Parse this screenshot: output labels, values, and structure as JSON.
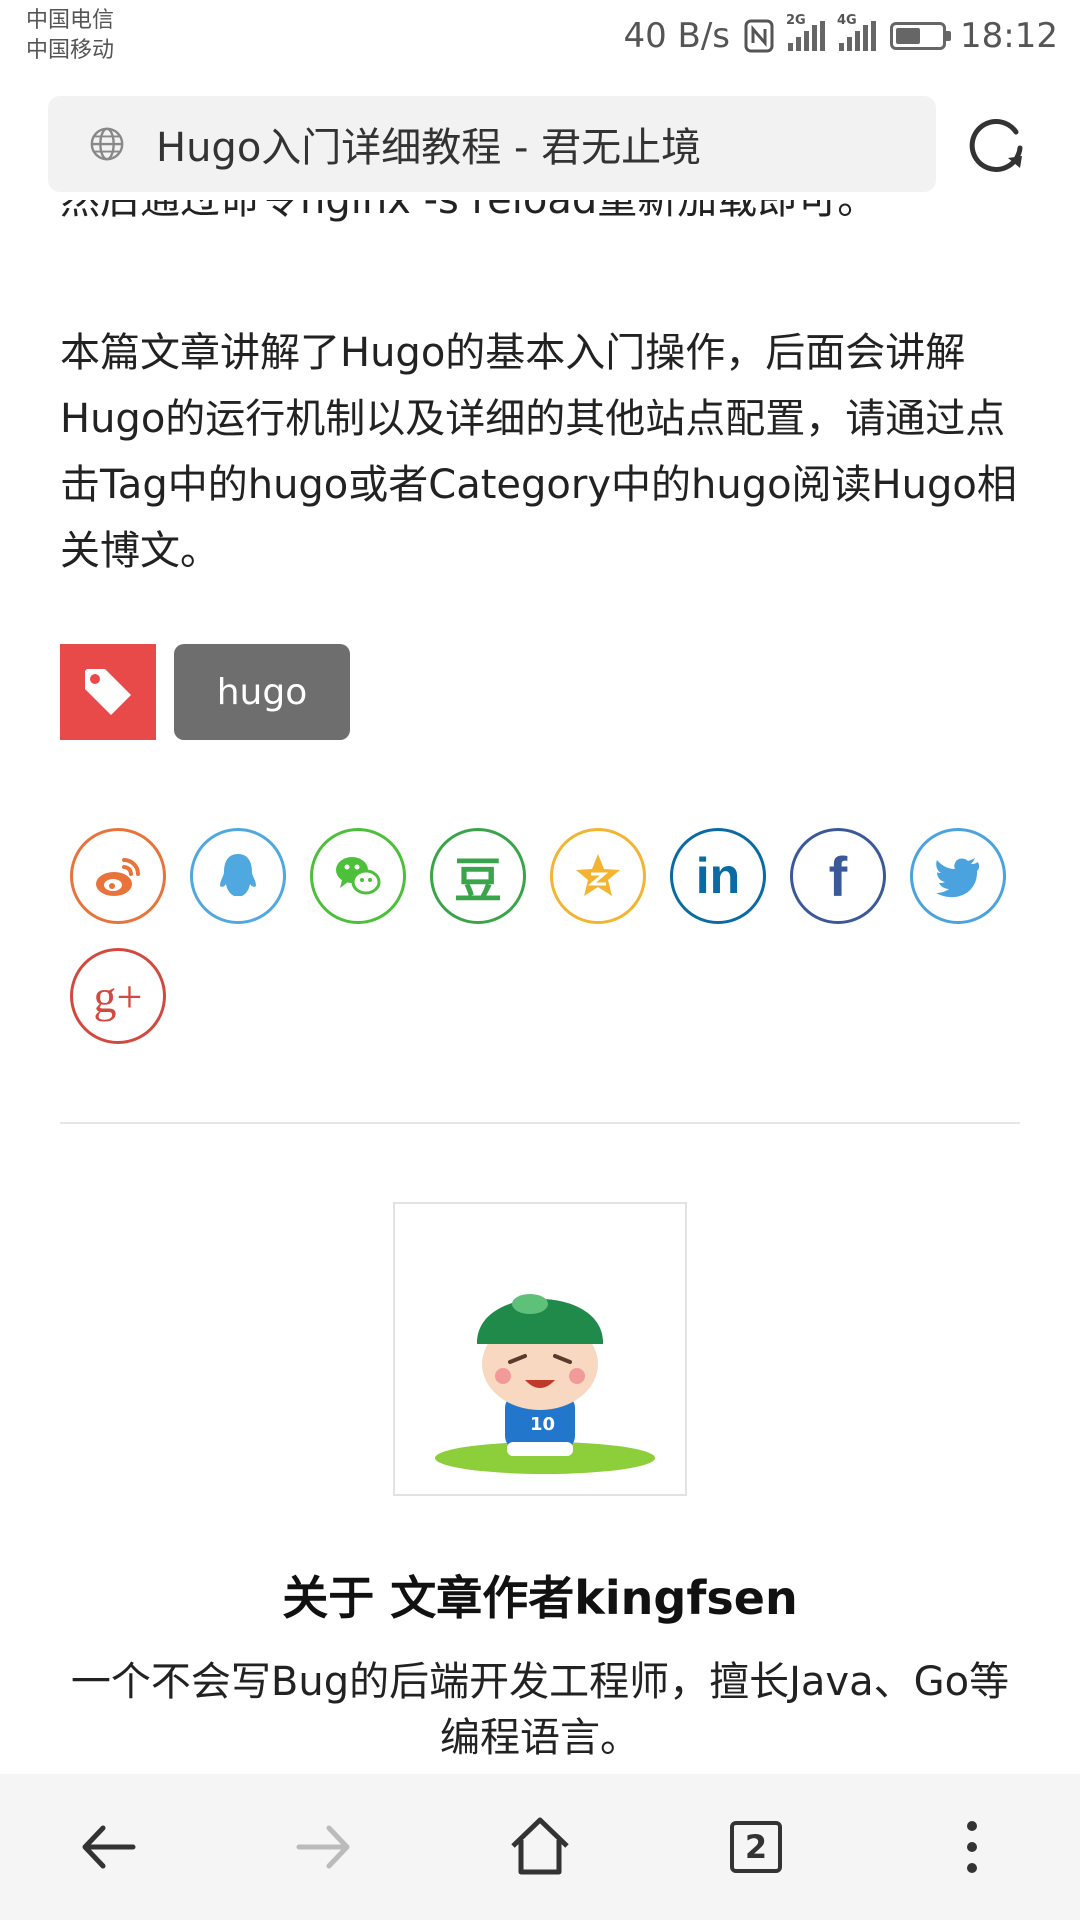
{
  "status_bar": {
    "carrier_1": "中国电信",
    "carrier_2": "中国移动",
    "network_speed": "40 B/s",
    "signal_1_label": "2G",
    "signal_2_label": "4G",
    "time": "18:12",
    "battery_level": 0.55
  },
  "address_bar": {
    "page_title": "Hugo入门详细教程 - 君无止境"
  },
  "article": {
    "cut_off_line": "然后通过命令nginx -s reload重新加载即可。",
    "paragraph": "本篇文章讲解了Hugo的基本入门操作，后面会讲解Hugo的运行机制以及详细的其他站点配置，请通过点击Tag中的hugo或者Category中的hugo阅读Hugo相关博文。",
    "tag": "hugo"
  },
  "share": {
    "icons": [
      "weibo-icon",
      "qq-icon",
      "wechat-icon",
      "douban-icon",
      "qzone-icon",
      "linkedin-icon",
      "facebook-icon",
      "twitter-icon",
      "google-plus-icon"
    ],
    "douban_glyph": "豆",
    "linkedin_glyph": "in",
    "facebook_glyph": "f",
    "gplus_glyph": "g+"
  },
  "author": {
    "title": "关于 文章作者kingfsen",
    "description": "一个不会写Bug的后端开发工程师，擅长Java、Go等编程语言。",
    "avatar_jersey": "10"
  },
  "bottom_nav": {
    "tab_count": "2"
  },
  "colors": {
    "tag_red": "#e84a4a",
    "tag_gray": "#6e6e6e",
    "weibo": "#e8743b",
    "qq": "#4fa8e0",
    "wechat": "#4cbf3b",
    "douban": "#3aa44a",
    "qzone": "#f3b531",
    "linkedin": "#0a6aa3",
    "facebook": "#3b5998",
    "twitter": "#4aa3df",
    "gplus": "#d24a3f"
  }
}
